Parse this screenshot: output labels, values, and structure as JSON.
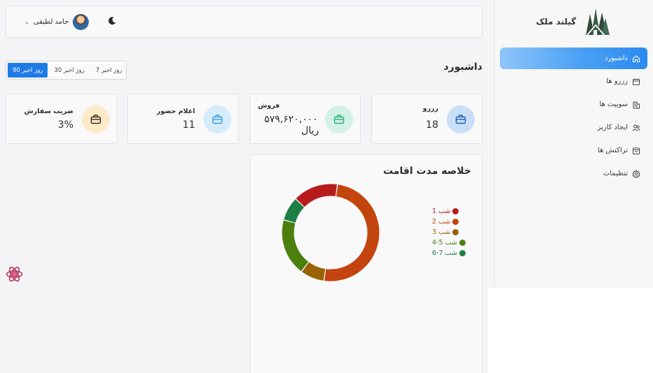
{
  "brand": {
    "name": "گیلند ملک"
  },
  "sidebar": {
    "items": [
      {
        "label": "داشبورد",
        "icon": "home-icon",
        "active": true
      },
      {
        "label": "رزرو ها",
        "icon": "calendar-icon",
        "active": false
      },
      {
        "label": "سوییت ها",
        "icon": "building-icon",
        "active": false
      },
      {
        "label": "ایجاد کاربر",
        "icon": "users-icon",
        "active": false
      },
      {
        "label": "تراکنش ها",
        "icon": "receipt-icon",
        "active": false
      },
      {
        "label": "تنظیمات",
        "icon": "gear-icon",
        "active": false
      }
    ]
  },
  "header": {
    "user_name": "حامد لطیفی",
    "theme_icon": "moon-icon"
  },
  "page": {
    "title": "داشبورد"
  },
  "filters": [
    {
      "label": "7 روز اخیر",
      "active": false
    },
    {
      "label": "30 روز اخیر",
      "active": false
    },
    {
      "label": "90 روز اخیر",
      "active": true
    }
  ],
  "cards": [
    {
      "label": "رزرو",
      "value": "18",
      "icon": "briefcase-icon",
      "color": "#c9def7"
    },
    {
      "label": "فروش",
      "value": "۵۷۹,۶۲۰,۰۰۰",
      "unit": "ریال",
      "icon": "briefcase-icon",
      "color": "#d3f1e6"
    },
    {
      "label": "اعلام حضور",
      "value": "11",
      "icon": "briefcase-icon",
      "color": "#d6ecfb"
    },
    {
      "label": "ضریب سفارش",
      "value": "3%",
      "icon": "briefcase-icon",
      "color": "#fbecc9"
    }
  ],
  "stay_summary": {
    "title": "خلاصه مدت اقامت"
  },
  "chart_data": {
    "type": "pie",
    "categories": [
      "1 شب",
      "2 شب",
      "3 شب",
      "4-5 شب",
      "6-7 شب"
    ],
    "values": [
      15,
      50,
      8,
      19,
      8
    ],
    "colors": [
      "#b71c1c",
      "#c4440e",
      "#9a6205",
      "#4d7f0f",
      "#1e7f46"
    ]
  }
}
